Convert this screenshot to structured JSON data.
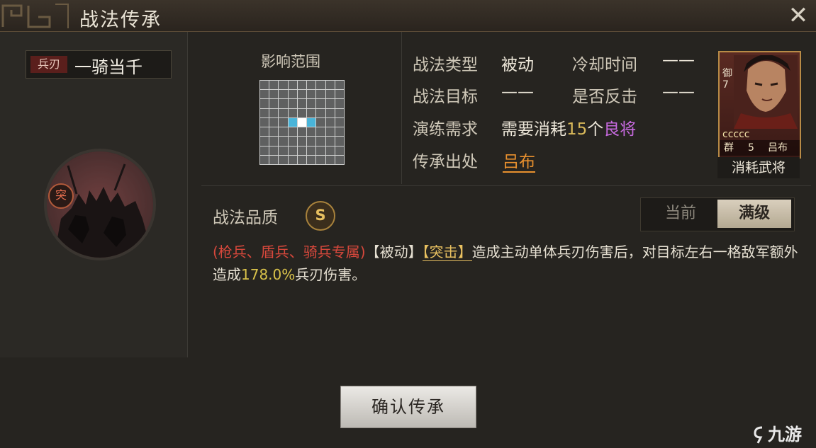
{
  "window": {
    "title": "战法传承",
    "close_icon": "close-icon"
  },
  "skill": {
    "damage_type_tag": "兵刃",
    "name": "一骑当千",
    "type_badge": "突"
  },
  "range": {
    "title": "影响范围",
    "grid_cols": 9,
    "grid_rows": 9,
    "highlight": {
      "self": [
        4,
        4
      ],
      "targets": [
        [
          4,
          3
        ],
        [
          4,
          5
        ]
      ]
    }
  },
  "info": {
    "type_label": "战法类型",
    "type_value": "被动",
    "cooldown_label": "冷却时间",
    "cooldown_value": "——",
    "target_label": "战法目标",
    "target_value": "——",
    "counter_label": "是否反击",
    "counter_value": "——",
    "drill_label": "演练需求",
    "drill_prefix": "需要消耗",
    "drill_count": "15",
    "drill_unit": "个",
    "drill_item": "良将",
    "source_label": "传承出处",
    "source_value": "吕布"
  },
  "card": {
    "side_text": "御7",
    "faction": "群",
    "cost": "5",
    "name": "吕布",
    "stars": "ccccc",
    "caption": "消耗武将"
  },
  "quality": {
    "label": "战法品质",
    "grade": "S"
  },
  "level_toggle": {
    "current": "当前",
    "full": "满级",
    "selected": "full"
  },
  "description": {
    "restriction": "(枪兵、盾兵、骑兵专属)",
    "tag1": "【被动】",
    "tag2": "【突击】",
    "text1": "造成主动单体兵刃伤害后，对目标左右一格敌军额外造成",
    "percent": "178.0%",
    "text2": "兵刃伤害。"
  },
  "confirm_button": "确认传承",
  "watermark": "九游",
  "colors": {
    "accent_gold": "#d9b95a",
    "source_orange": "#e8902e",
    "purple": "#c86ae0",
    "red": "#d8483c",
    "range_target": "#49b4d9"
  }
}
